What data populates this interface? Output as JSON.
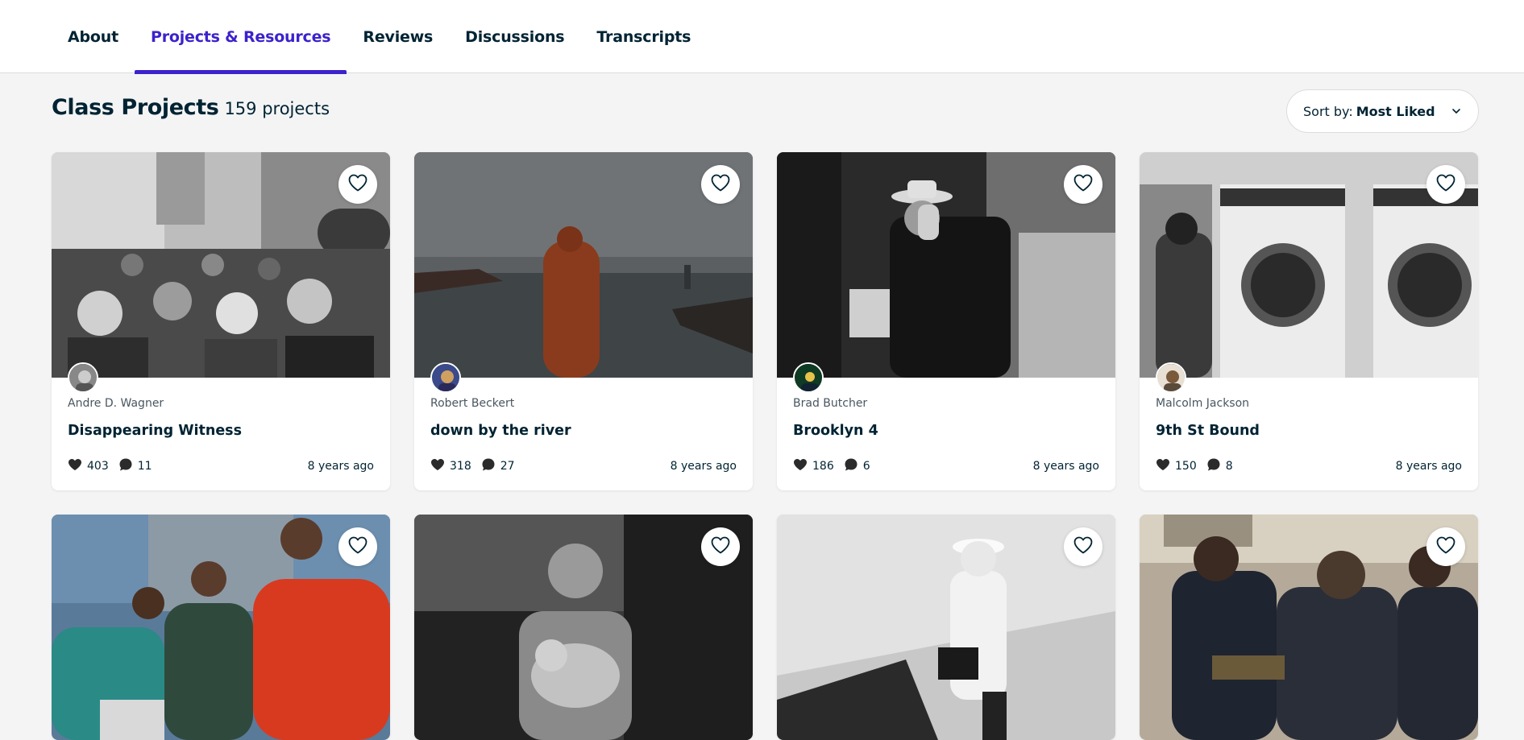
{
  "tabs": [
    {
      "label": "About"
    },
    {
      "label": "Projects & Resources"
    },
    {
      "label": "Reviews"
    },
    {
      "label": "Discussions"
    },
    {
      "label": "Transcripts"
    }
  ],
  "active_tab": "Projects & Resources",
  "section": {
    "title": "Class Projects",
    "count": "159 projects"
  },
  "sort": {
    "label": "Sort by:",
    "value": "Most Liked"
  },
  "colors": {
    "accent": "#3b22cc",
    "text": "#002333",
    "background": "#f4f4f4"
  },
  "projects": [
    {
      "author": "Andre D. Wagner",
      "title": "Disappearing Witness",
      "likes": "403",
      "comments": "11",
      "age": "8 years ago",
      "image": "crowd-street-bw"
    },
    {
      "author": "Robert Beckert",
      "title": "down by the river",
      "likes": "318",
      "comments": "27",
      "age": "8 years ago",
      "image": "monk-river-fog"
    },
    {
      "author": "Brad Butcher",
      "title": "Brooklyn 4",
      "likes": "186",
      "comments": "6",
      "age": "8 years ago",
      "image": "man-hat-hand-bw"
    },
    {
      "author": "Malcolm Jackson",
      "title": "9th St Bound",
      "likes": "150",
      "comments": "8",
      "age": "8 years ago",
      "image": "laundromat-bw"
    },
    {
      "author": "",
      "title": "",
      "likes": "",
      "comments": "",
      "age": "",
      "image": "group-street-color"
    },
    {
      "author": "",
      "title": "",
      "likes": "",
      "comments": "",
      "age": "",
      "image": "boy-dog-bw"
    },
    {
      "author": "",
      "title": "",
      "likes": "",
      "comments": "",
      "age": "",
      "image": "man-briefcase-bw"
    },
    {
      "author": "",
      "title": "",
      "likes": "",
      "comments": "",
      "age": "",
      "image": "subway-commuters"
    }
  ]
}
